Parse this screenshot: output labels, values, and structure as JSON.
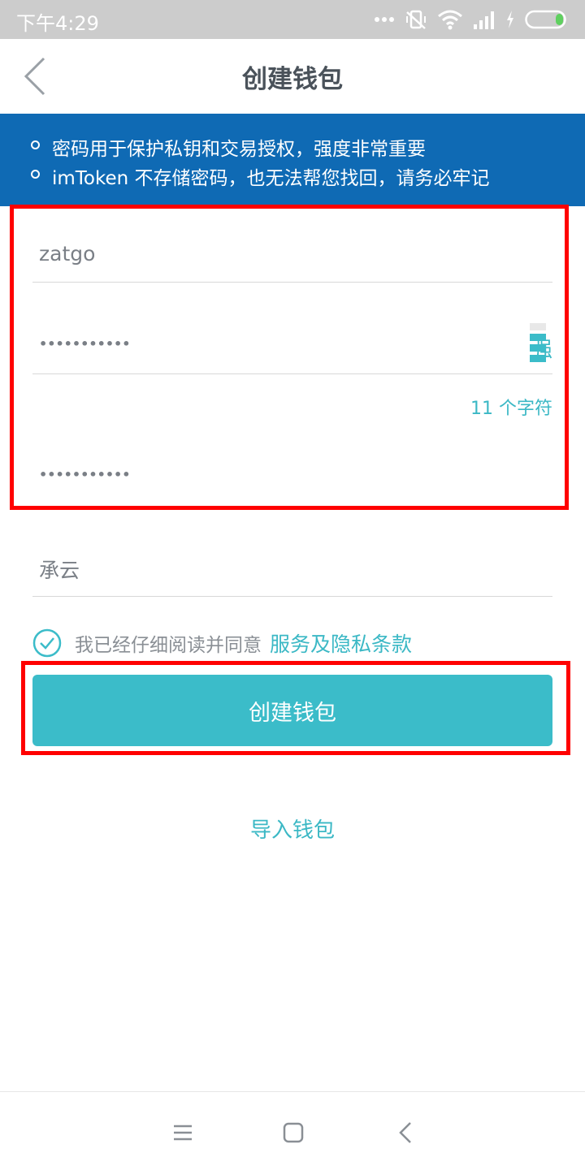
{
  "status_bar": {
    "time": "下午4:29",
    "icons": [
      "more-dots-icon",
      "vibrate-off-icon",
      "wifi-icon",
      "signal-icon",
      "charging-icon",
      "battery-icon"
    ]
  },
  "header": {
    "title": "创建钱包",
    "back_icon": "chevron-left-icon"
  },
  "notice": {
    "lines": [
      "密码用于保护私钥和交易授权，强度非常重要",
      "imToken 不存储密码，也无法帮您找回，请务必牢记"
    ]
  },
  "form": {
    "wallet_name": "zatgo",
    "password_masked": "•••••••••••",
    "strength_label": "强",
    "strength_level": 3,
    "strength_levels_total": 4,
    "char_count": "11 个字符",
    "confirm_password_masked": "•••••••••••",
    "hint": "承云"
  },
  "agreement": {
    "checked": true,
    "text": "我已经仔细阅读并同意",
    "link": "服务及隐私条款"
  },
  "actions": {
    "create": "创建钱包",
    "import": "导入钱包"
  },
  "nav_bar": {
    "icons": [
      "menu-icon",
      "home-icon",
      "back-icon"
    ]
  },
  "colors": {
    "accent": "#3bbcc9",
    "banner": "#0f6ab4",
    "highlight": "#ff0000",
    "status_bar": "#cccccc"
  }
}
